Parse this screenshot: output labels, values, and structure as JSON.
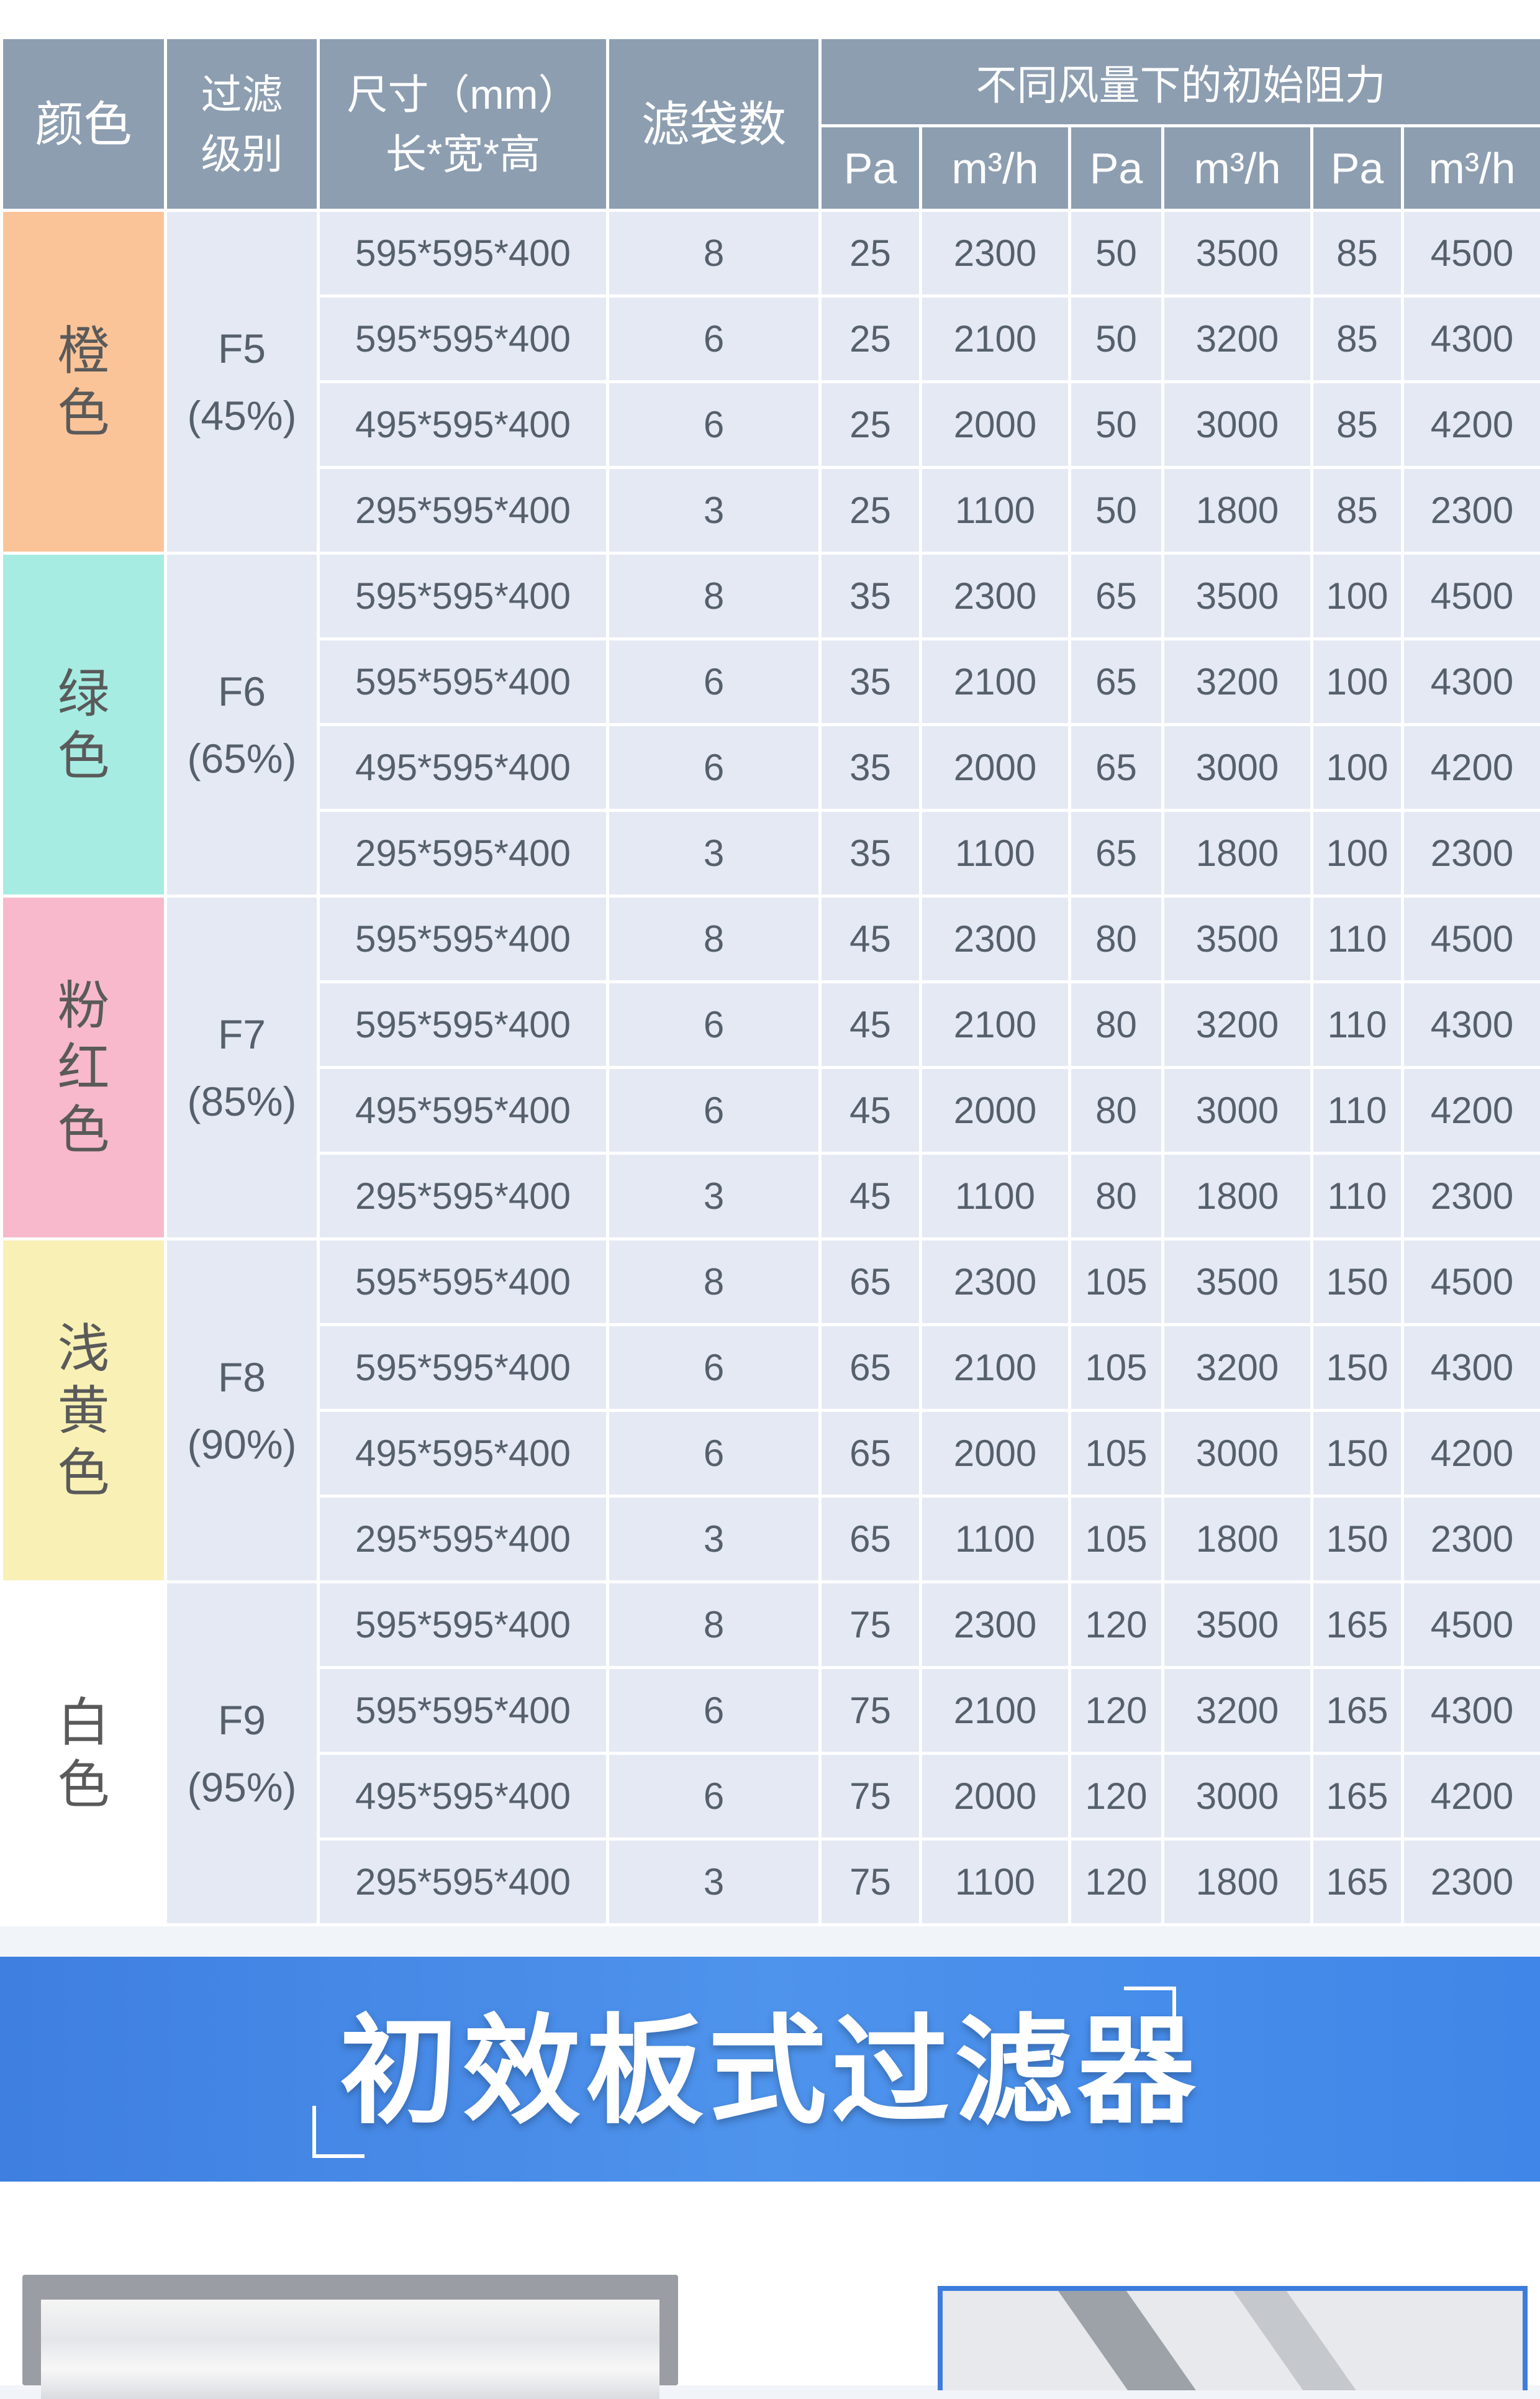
{
  "table": {
    "headers": {
      "color": "颜色",
      "grade_line1": "过滤",
      "grade_line2": "级别",
      "size_line1": "尺寸（mm）",
      "size_line2": "长*宽*高",
      "bags": "滤袋数",
      "resistance": "不同风量下的初始阻力",
      "pa": "Pa",
      "flow": "m³/h"
    },
    "groups": [
      {
        "color_chars": [
          "橙",
          "色"
        ],
        "grade": "F5",
        "efficiency": "(45%)",
        "rows": [
          {
            "size": "595*595*400",
            "bags": "8",
            "pa1": "25",
            "q1": "2300",
            "pa2": "50",
            "q2": "3500",
            "pa3": "85",
            "q3": "4500"
          },
          {
            "size": "595*595*400",
            "bags": "6",
            "pa1": "25",
            "q1": "2100",
            "pa2": "50",
            "q2": "3200",
            "pa3": "85",
            "q3": "4300"
          },
          {
            "size": "495*595*400",
            "bags": "6",
            "pa1": "25",
            "q1": "2000",
            "pa2": "50",
            "q2": "3000",
            "pa3": "85",
            "q3": "4200"
          },
          {
            "size": "295*595*400",
            "bags": "3",
            "pa1": "25",
            "q1": "1100",
            "pa2": "50",
            "q2": "1800",
            "pa3": "85",
            "q3": "2300"
          }
        ]
      },
      {
        "color_chars": [
          "绿",
          "色"
        ],
        "grade": "F6",
        "efficiency": "(65%)",
        "rows": [
          {
            "size": "595*595*400",
            "bags": "8",
            "pa1": "35",
            "q1": "2300",
            "pa2": "65",
            "q2": "3500",
            "pa3": "100",
            "q3": "4500"
          },
          {
            "size": "595*595*400",
            "bags": "6",
            "pa1": "35",
            "q1": "2100",
            "pa2": "65",
            "q2": "3200",
            "pa3": "100",
            "q3": "4300"
          },
          {
            "size": "495*595*400",
            "bags": "6",
            "pa1": "35",
            "q1": "2000",
            "pa2": "65",
            "q2": "3000",
            "pa3": "100",
            "q3": "4200"
          },
          {
            "size": "295*595*400",
            "bags": "3",
            "pa1": "35",
            "q1": "1100",
            "pa2": "65",
            "q2": "1800",
            "pa3": "100",
            "q3": "2300"
          }
        ]
      },
      {
        "color_chars": [
          "粉",
          "红",
          "色"
        ],
        "grade": "F7",
        "efficiency": "(85%)",
        "rows": [
          {
            "size": "595*595*400",
            "bags": "8",
            "pa1": "45",
            "q1": "2300",
            "pa2": "80",
            "q2": "3500",
            "pa3": "110",
            "q3": "4500"
          },
          {
            "size": "595*595*400",
            "bags": "6",
            "pa1": "45",
            "q1": "2100",
            "pa2": "80",
            "q2": "3200",
            "pa3": "110",
            "q3": "4300"
          },
          {
            "size": "495*595*400",
            "bags": "6",
            "pa1": "45",
            "q1": "2000",
            "pa2": "80",
            "q2": "3000",
            "pa3": "110",
            "q3": "4200"
          },
          {
            "size": "295*595*400",
            "bags": "3",
            "pa1": "45",
            "q1": "1100",
            "pa2": "80",
            "q2": "1800",
            "pa3": "110",
            "q3": "2300"
          }
        ]
      },
      {
        "color_chars": [
          "浅",
          "黄",
          "色"
        ],
        "grade": "F8",
        "efficiency": "(90%)",
        "rows": [
          {
            "size": "595*595*400",
            "bags": "8",
            "pa1": "65",
            "q1": "2300",
            "pa2": "105",
            "q2": "3500",
            "pa3": "150",
            "q3": "4500"
          },
          {
            "size": "595*595*400",
            "bags": "6",
            "pa1": "65",
            "q1": "2100",
            "pa2": "105",
            "q2": "3200",
            "pa3": "150",
            "q3": "4300"
          },
          {
            "size": "495*595*400",
            "bags": "6",
            "pa1": "65",
            "q1": "2000",
            "pa2": "105",
            "q2": "3000",
            "pa3": "150",
            "q3": "4200"
          },
          {
            "size": "295*595*400",
            "bags": "3",
            "pa1": "65",
            "q1": "1100",
            "pa2": "105",
            "q2": "1800",
            "pa3": "150",
            "q3": "2300"
          }
        ]
      },
      {
        "color_chars": [
          "白",
          "色"
        ],
        "grade": "F9",
        "efficiency": "(95%)",
        "rows": [
          {
            "size": "595*595*400",
            "bags": "8",
            "pa1": "75",
            "q1": "2300",
            "pa2": "120",
            "q2": "3500",
            "pa3": "165",
            "q3": "4500"
          },
          {
            "size": "595*595*400",
            "bags": "6",
            "pa1": "75",
            "q1": "2100",
            "pa2": "120",
            "q2": "3200",
            "pa3": "165",
            "q3": "4300"
          },
          {
            "size": "495*595*400",
            "bags": "6",
            "pa1": "75",
            "q1": "2000",
            "pa2": "120",
            "q2": "3000",
            "pa3": "165",
            "q3": "4200"
          },
          {
            "size": "295*595*400",
            "bags": "3",
            "pa1": "75",
            "q1": "1100",
            "pa2": "120",
            "q2": "1800",
            "pa3": "165",
            "q3": "2300"
          }
        ]
      }
    ]
  },
  "banner": {
    "title": "初效板式过滤器"
  },
  "colors": {
    "header_bg": "#8d9eb1",
    "cell_bg": "#e4e9f3",
    "orange": "#fbc498",
    "green": "#a6ece3",
    "pink": "#f7b9cb",
    "yellow": "#f9f0b5",
    "white": "#ffffff",
    "banner_blue": "#4e93ec"
  }
}
